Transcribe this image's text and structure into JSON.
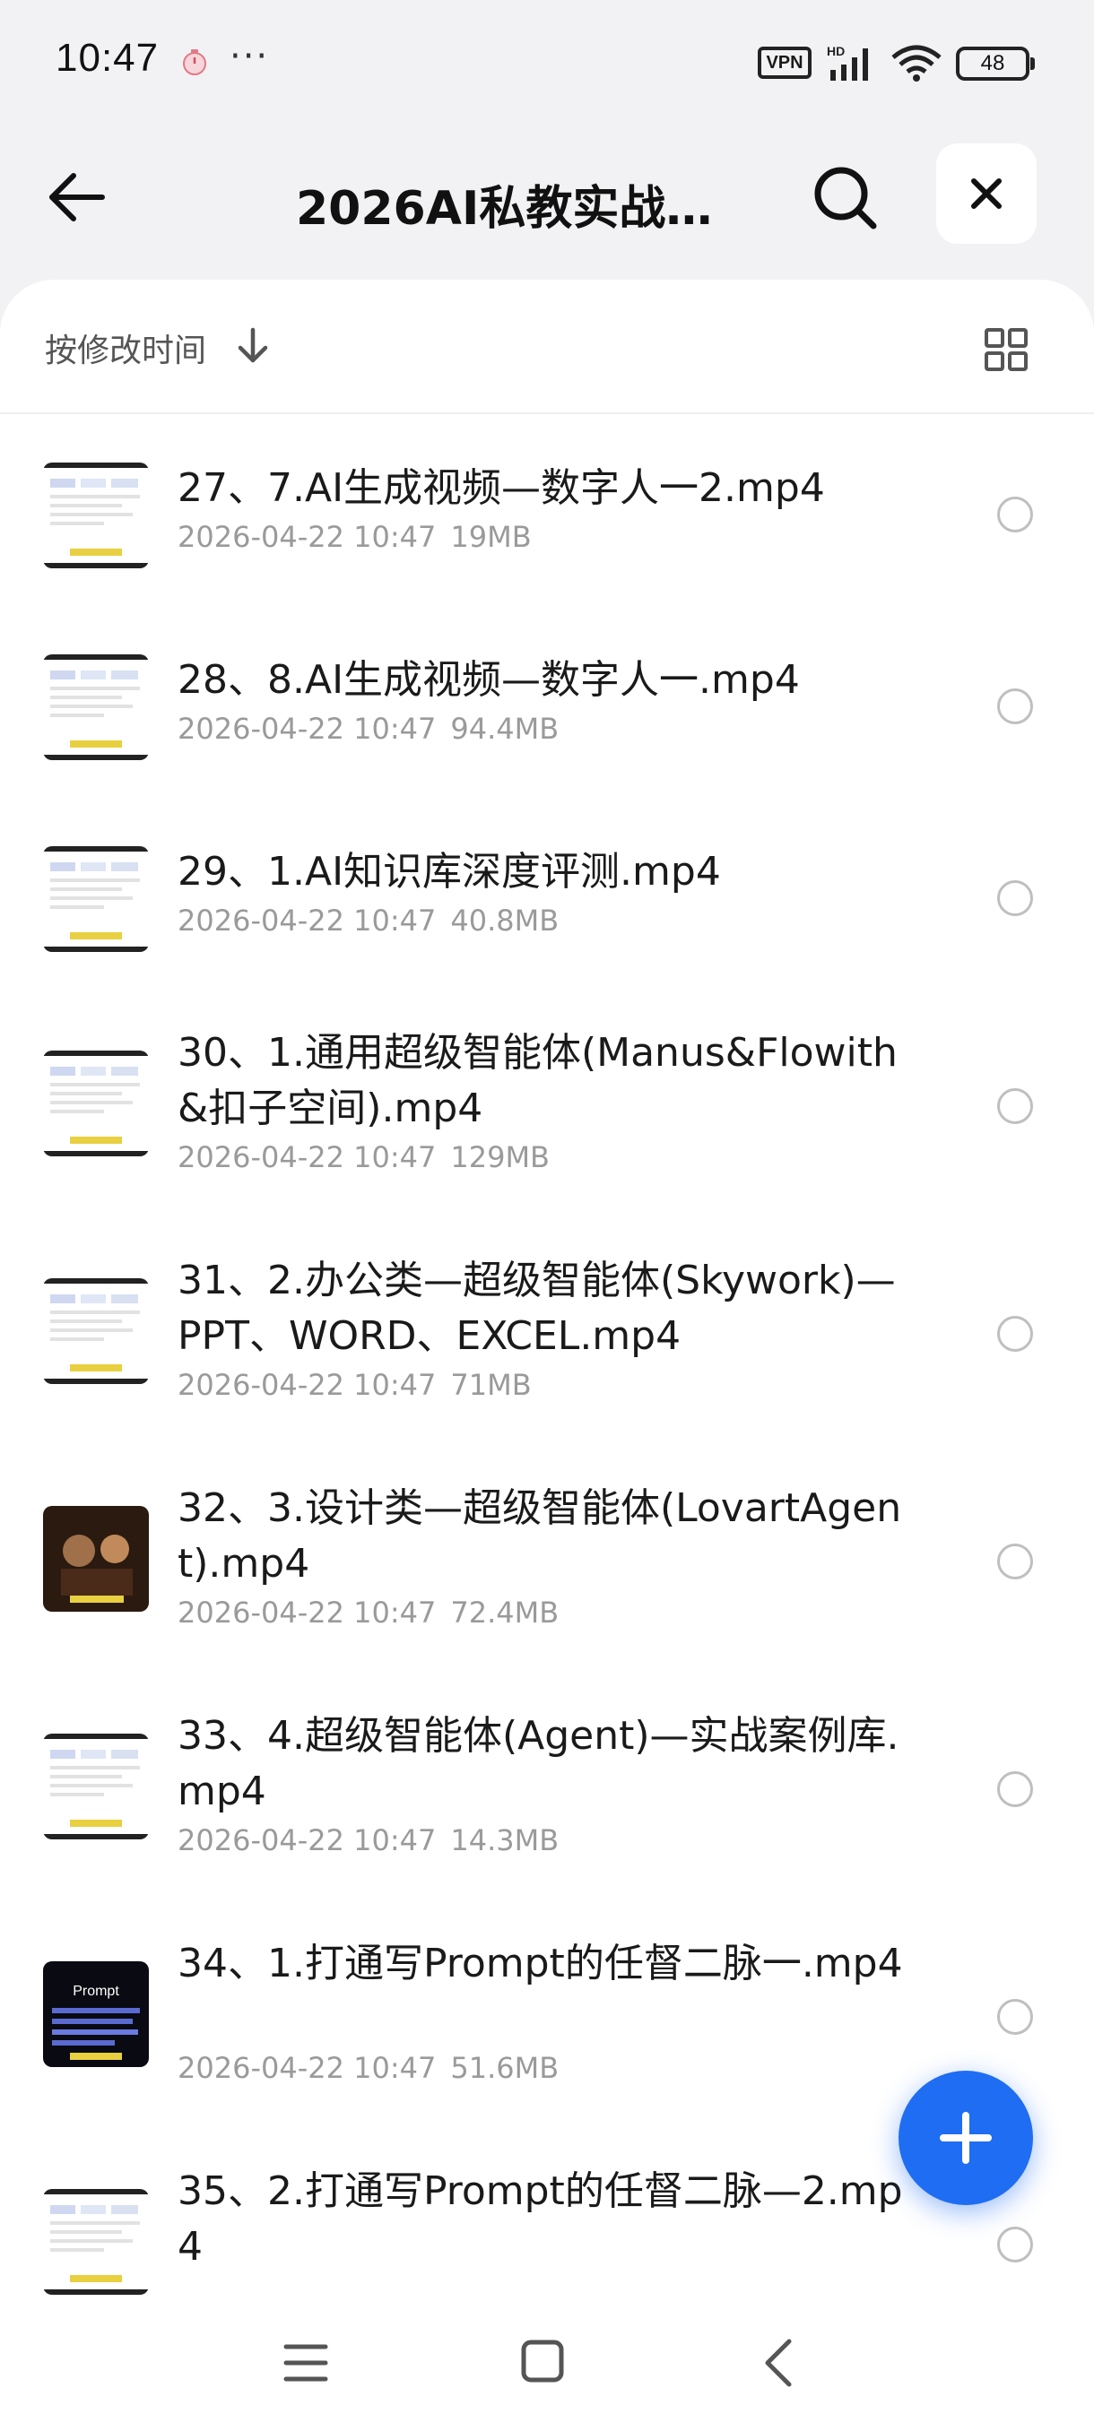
{
  "status_bar": {
    "time": "10:47",
    "more": "···",
    "vpn": "VPN",
    "hd": "HD",
    "battery": "48",
    "icons": [
      "timer-icon",
      "signal-icon",
      "wifi-icon",
      "battery-icon"
    ]
  },
  "header": {
    "title": "2026AI私教实战课…",
    "icons": [
      "back-arrow-icon",
      "search-icon",
      "close-icon"
    ]
  },
  "sort_bar": {
    "label": "按修改时间",
    "icons": [
      "sort-down-arrow-icon",
      "grid-view-icon"
    ]
  },
  "files": [
    {
      "name": "27、7.AI生成视频—数字人一2.mp4",
      "date": "2026-04-22 10:47",
      "size": "19MB",
      "thumb": "light"
    },
    {
      "name": "28、8.AI生成视频—数字人一.mp4",
      "date": "2026-04-22 10:47",
      "size": "94.4MB",
      "thumb": "light"
    },
    {
      "name": "29、1.AI知识库深度评测.mp4",
      "date": "2026-04-22 10:47",
      "size": "40.8MB",
      "thumb": "light"
    },
    {
      "name": "30、1.通用超级智能体(Manus&Flowith&扣子空间).mp4",
      "date": "2026-04-22 10:47",
      "size": "129MB",
      "thumb": "light"
    },
    {
      "name": "31、2.办公类—超级智能体(Skywork)—PPT、WORD、EXCEL.mp4",
      "date": "2026-04-22 10:47",
      "size": "71MB",
      "thumb": "light"
    },
    {
      "name": "32、3.设计类—超级智能体(LovartAgent).mp4",
      "date": "2026-04-22 10:47",
      "size": "72.4MB",
      "thumb": "dark-photo"
    },
    {
      "name": "33、4.超级智能体(Agent)—实战案例库.mp4",
      "date": "2026-04-22 10:47",
      "size": "14.3MB",
      "thumb": "light"
    },
    {
      "name": "34、1.打通写Prompt的任督二脉一.mp4",
      "date": "2026-04-22 10:47",
      "size": "51.6MB",
      "thumb": "dark-text",
      "thumb_text": "Prompt"
    },
    {
      "name": "35、2.打通写Prompt的任督二脉—2.mp4",
      "date": "",
      "size": "",
      "thumb": "light"
    }
  ],
  "fab": {
    "icon": "plus-icon"
  },
  "nav_bar": {
    "icons": [
      "menu-icon",
      "home-square-icon",
      "back-chevron-icon"
    ]
  },
  "colors": {
    "accent": "#1f6df2",
    "background": "#f2f2f4",
    "meta_text": "#9a9a9a"
  }
}
